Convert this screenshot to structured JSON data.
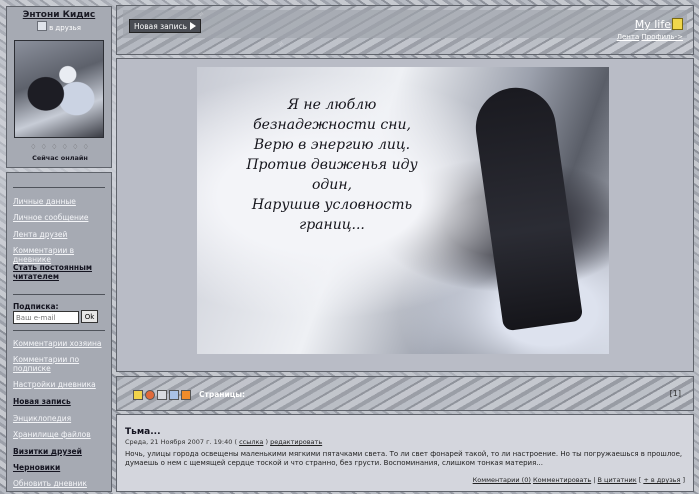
{
  "profile": {
    "name": "Энтони Кидис",
    "friend_link": "в друзья",
    "rating": "♢ ♢ ♢ ♢ ♢ ♢",
    "online_status": "Сейчас онлайн"
  },
  "menu": {
    "items": [
      {
        "label": "Личные данные"
      },
      {
        "label": "Личное сообщение"
      },
      {
        "label": "Лента друзей"
      },
      {
        "label": "Комментарии в дневнике"
      },
      {
        "label": "Стать постоянным читателем"
      }
    ],
    "subscription": {
      "label": "Подписка:",
      "email_placeholder": "Ваш e-mail",
      "ok_label": "Ok"
    },
    "items2": [
      {
        "label": "Комментарии хозяина"
      },
      {
        "label": "Комментарии по подписке"
      },
      {
        "label": "Настройки дневника"
      },
      {
        "label": "Новая запись"
      },
      {
        "label": "Энциклопедия"
      },
      {
        "label": "Хранилище файлов"
      },
      {
        "label": "Визитки друзей"
      },
      {
        "label": "Черновики"
      },
      {
        "label": "Обновить дневник"
      }
    ]
  },
  "header": {
    "new_post_label": "Новая запись",
    "blog_title": "My life",
    "link_feed": "Лента",
    "link_profile": "Профиль->"
  },
  "banner": {
    "poem_lines": [
      "Я не люблю",
      "безнадежности сни,",
      "Верю в энергию лиц.",
      "Против движенья иду",
      "один,",
      "Нарушив условность",
      "границ..."
    ]
  },
  "toolbar": {
    "pages_label": "Страницы:",
    "right_mark": "[1]"
  },
  "post": {
    "title": "Тьма...",
    "date": "Среда, 21 Ноября 2007 г. 19:40",
    "link_ref": "ссылка",
    "link_edit": "редактировать",
    "text": "Ночь, улицы города освещены маленькими мягкими пятачками света. То ли свет фонарей такой, то ли настроение. Но ты погружаешься в прошлое, думаешь о нем с щемящей сердце тоской и что странно, без грусти. Воспоминания, слишком тонкая материя...",
    "footer": {
      "comments": "Комментарии (0)",
      "comment": "Комментировать",
      "quote": "В цитатник",
      "friends": "+ в друзья"
    }
  },
  "colors": {
    "sidebar_bg": "#a6aab3",
    "post_bg": "#d4d6dd",
    "border": "#5f636b"
  }
}
